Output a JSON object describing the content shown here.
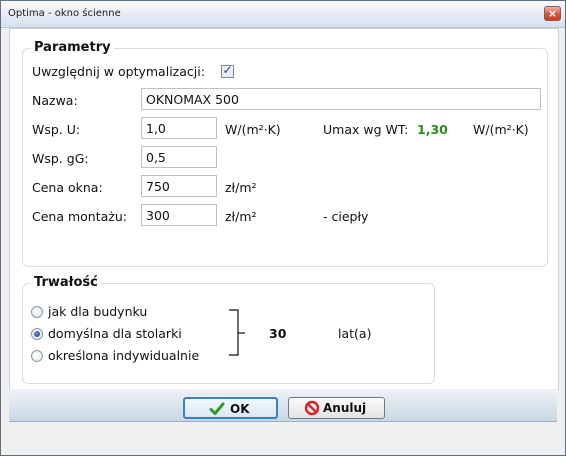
{
  "window": {
    "title": "Optima - okno ścienne",
    "close_glyph": "×"
  },
  "parametry": {
    "group_title": "Parametry",
    "optimize_label": "Uwzględnij w optymalizacji:",
    "optimize_checked": true,
    "check_glyph": "✓",
    "name_label": "Nazwa:",
    "name_value": "OKNOMAX 500",
    "u_label": "Wsp. U:",
    "u_value": "1,0",
    "u_unit": "W/(m²·K)",
    "umax_label": "Umax wg WT:",
    "umax_value": "1,30",
    "umax_unit": "W/(m²·K)",
    "umax_color": "#2e8b1e",
    "gg_label": "Wsp. gG:",
    "gg_value": "0,5",
    "price_label": "Cena okna:",
    "price_value": "750",
    "price_unit": "zł/m²",
    "install_label": "Cena montażu:",
    "install_value": "300",
    "install_unit": "zł/m²",
    "install_note": "- ciepły"
  },
  "trwalosc": {
    "group_title": "Trwałość",
    "options": [
      {
        "label": "jak dla budynku",
        "selected": false
      },
      {
        "label": "domyślna dla stolarki",
        "selected": true
      },
      {
        "label": "określona indywidualnie",
        "selected": false
      }
    ],
    "years_value": "30",
    "years_unit": "lat(a)"
  },
  "buttons": {
    "ok_label": "OK",
    "ok_icon": "check-icon",
    "cancel_label": "Anuluj",
    "cancel_icon": "no-entry-icon"
  }
}
